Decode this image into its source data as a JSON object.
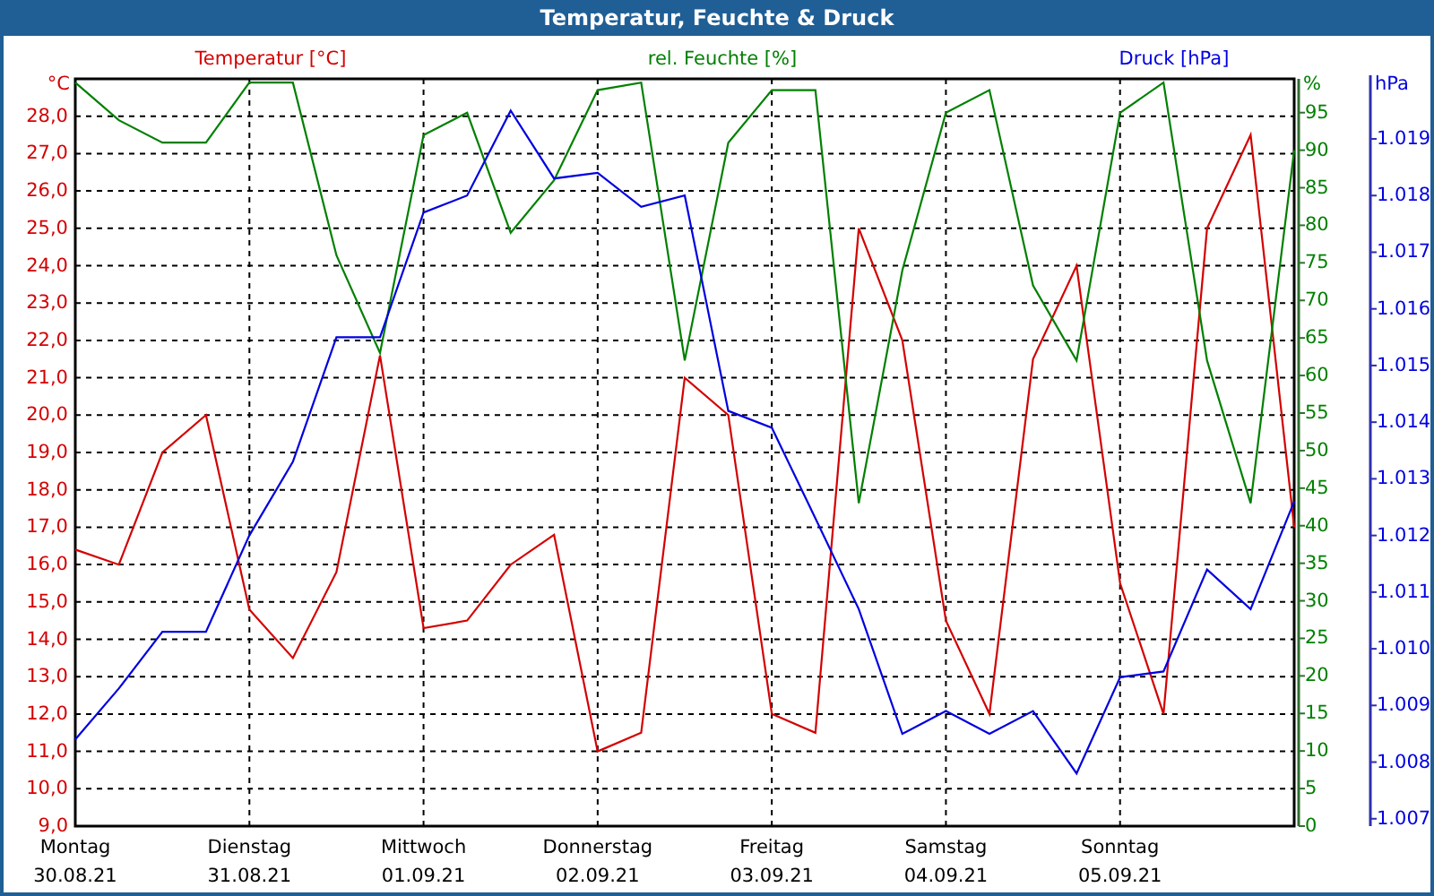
{
  "window": {
    "title": "Temperatur, Feuchte & Druck"
  },
  "chart": {
    "chart_data": {
      "type": "line",
      "grid": true,
      "ylabel": "°C",
      "y2label": "%",
      "y3label": "hPa",
      "categories": [
        "Montag",
        null,
        null,
        null,
        "Dienstag",
        null,
        null,
        null,
        "Mittwoch",
        null,
        null,
        null,
        "Donnerstag",
        null,
        null,
        null,
        "Freitag",
        null,
        null,
        null,
        "Samstag",
        null,
        null,
        null,
        "Sonntag",
        null,
        null,
        null,
        null
      ],
      "ylim": [
        9,
        29
      ],
      "yticks": [
        {
          "value": 28,
          "label": "28,0"
        },
        {
          "value": 27,
          "label": "27,0"
        },
        {
          "value": 26,
          "label": "26,0"
        },
        {
          "value": 25,
          "label": "25,0"
        },
        {
          "value": 24,
          "label": "24,0"
        },
        {
          "value": 23,
          "label": "23,0"
        },
        {
          "value": 22,
          "label": "22,0"
        },
        {
          "value": 21,
          "label": "21,0"
        },
        {
          "value": 20,
          "label": "20,0"
        },
        {
          "value": 19,
          "label": "19,0"
        },
        {
          "value": 18,
          "label": "18,0"
        },
        {
          "value": 17,
          "label": "17,0"
        },
        {
          "value": 16,
          "label": "16,0"
        },
        {
          "value": 15,
          "label": "15,0"
        },
        {
          "value": 14,
          "label": "14,0"
        },
        {
          "value": 13,
          "label": "13,0"
        },
        {
          "value": 12,
          "label": "12,0"
        },
        {
          "value": 11,
          "label": "11,0"
        },
        {
          "value": 10,
          "label": "10,0"
        },
        {
          "value": 9,
          "label": "9,0"
        }
      ],
      "y2lim": [
        0,
        99.5
      ],
      "y2ticks": [
        95,
        90,
        85,
        80,
        75,
        70,
        65,
        60,
        55,
        50,
        45,
        40,
        35,
        30,
        25,
        20,
        15,
        10,
        5,
        0
      ],
      "y3lim": [
        1006.87,
        1020.06
      ],
      "y3ticks": [
        {
          "value": 1019,
          "label": "1.019"
        },
        {
          "value": 1018,
          "label": "1.018"
        },
        {
          "value": 1017,
          "label": "1.017"
        },
        {
          "value": 1016,
          "label": "1.016"
        },
        {
          "value": 1015,
          "label": "1.015"
        },
        {
          "value": 1014,
          "label": "1.014"
        },
        {
          "value": 1013,
          "label": "1.013"
        },
        {
          "value": 1012,
          "label": "1.012"
        },
        {
          "value": 1011,
          "label": "1.011"
        },
        {
          "value": 1010,
          "label": "1.010"
        },
        {
          "value": 1009,
          "label": "1.009"
        },
        {
          "value": 1008,
          "label": "1.008"
        },
        {
          "value": 1007,
          "label": "1.007"
        }
      ],
      "series": [
        {
          "name": "Temperatur [°C]",
          "color": "#d40000",
          "values": [
            16.4,
            16.0,
            19.0,
            20.0,
            14.8,
            13.5,
            15.8,
            21.6,
            14.3,
            14.5,
            16.0,
            16.8,
            11.0,
            11.5,
            21.0,
            20.0,
            12.0,
            11.5,
            25.0,
            22.0,
            14.5,
            12.0,
            21.5,
            24.0,
            15.5,
            12.0,
            25.0,
            27.5,
            17.0
          ]
        },
        {
          "name": "rel. Feuchte [%]",
          "color": "#008000",
          "axis": "y2",
          "values": [
            99,
            94,
            91,
            91,
            99,
            99,
            76,
            63,
            92,
            95,
            79,
            86,
            98,
            99,
            62,
            91,
            98,
            98,
            43,
            74,
            95,
            98,
            72,
            62,
            95,
            99,
            62,
            43,
            90
          ]
        },
        {
          "name": "Druck [hPa]",
          "color": "#0000e0",
          "axis": "y3",
          "values": [
            1008.4,
            1009.3,
            1010.3,
            1010.3,
            1012.0,
            1013.3,
            1015.5,
            1015.5,
            1017.7,
            1018.0,
            1019.5,
            1018.3,
            1018.4,
            1017.8,
            1018.0,
            1014.2,
            1013.9,
            1012.3,
            1010.7,
            1008.5,
            1008.9,
            1008.5,
            1008.9,
            1007.8,
            1009.5,
            1009.6,
            1011.4,
            1010.7,
            1012.6
          ]
        }
      ]
    },
    "x_dates": [
      "30.08.21",
      "31.08.21",
      "01.09.21",
      "02.09.21",
      "03.09.21",
      "04.09.21",
      "05.09.21"
    ]
  }
}
